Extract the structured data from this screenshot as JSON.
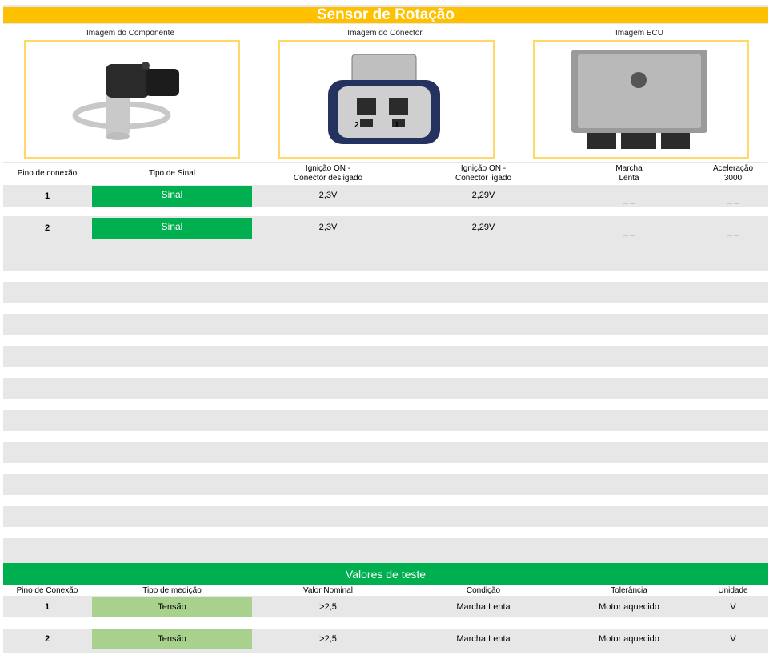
{
  "title": "Sensor de Rotação",
  "images": {
    "component_label": "Imagem do Componente",
    "connector_label": "Imagem do Conector",
    "ecu_label": "Imagem ECU",
    "connector_pin_2": "2",
    "connector_pin_1": "1"
  },
  "pin_table": {
    "headers": {
      "pin": "Pino de conexão",
      "signal_type": "Tipo de Sinal",
      "ign_off_1": "Ignição ON -",
      "ign_off_2": "Conector desligado",
      "ign_on_1": "Ignição ON -",
      "ign_on_2": "Conector ligado",
      "idle_1": "Marcha",
      "idle_2": "Lenta",
      "accel_1": "Aceleração",
      "accel_2": "3000"
    },
    "rows": [
      {
        "pin": "1",
        "signal": "Sinal",
        "disconnected": "2,3V",
        "connected": "2,29V",
        "idle": "_ _",
        "accel": "_ _"
      },
      {
        "pin": "2",
        "signal": "Sinal",
        "disconnected": "2,3V",
        "connected": "2,29V",
        "idle": "_ _",
        "accel": "_ _"
      }
    ]
  },
  "test_values": {
    "title": "Valores de teste",
    "headers": {
      "pin": "Pino de Conexão",
      "measure_type": "Tipo de medição",
      "nominal": "Valor Nominal",
      "condition": "Condição",
      "tolerance": "Tolerância",
      "unit": "Unidade"
    },
    "rows": [
      {
        "pin": "1",
        "measure": "Tensão",
        "nominal": ">2,5",
        "condition": "Marcha Lenta",
        "tolerance": "Motor aquecido",
        "unit": "V"
      },
      {
        "pin": "2",
        "measure": "Tensão",
        "nominal": ">2,5",
        "condition": "Marcha Lenta",
        "tolerance": "Motor aquecido",
        "unit": "V"
      }
    ]
  },
  "colors": {
    "title_bg": "#ffc000",
    "signal_green": "#00b050",
    "measure_green": "#a9d18e",
    "image_border": "#ffd966",
    "stripe_grey": "#e7e7e7"
  }
}
